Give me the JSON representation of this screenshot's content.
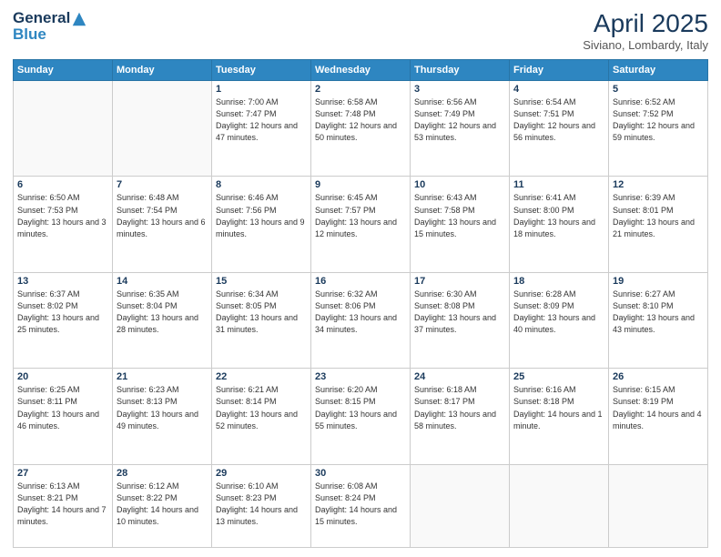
{
  "header": {
    "logo_line1": "General",
    "logo_line2": "Blue",
    "month": "April 2025",
    "location": "Siviano, Lombardy, Italy"
  },
  "weekdays": [
    "Sunday",
    "Monday",
    "Tuesday",
    "Wednesday",
    "Thursday",
    "Friday",
    "Saturday"
  ],
  "weeks": [
    [
      {
        "day": "",
        "info": ""
      },
      {
        "day": "",
        "info": ""
      },
      {
        "day": "1",
        "info": "Sunrise: 7:00 AM\nSunset: 7:47 PM\nDaylight: 12 hours and 47 minutes."
      },
      {
        "day": "2",
        "info": "Sunrise: 6:58 AM\nSunset: 7:48 PM\nDaylight: 12 hours and 50 minutes."
      },
      {
        "day": "3",
        "info": "Sunrise: 6:56 AM\nSunset: 7:49 PM\nDaylight: 12 hours and 53 minutes."
      },
      {
        "day": "4",
        "info": "Sunrise: 6:54 AM\nSunset: 7:51 PM\nDaylight: 12 hours and 56 minutes."
      },
      {
        "day": "5",
        "info": "Sunrise: 6:52 AM\nSunset: 7:52 PM\nDaylight: 12 hours and 59 minutes."
      }
    ],
    [
      {
        "day": "6",
        "info": "Sunrise: 6:50 AM\nSunset: 7:53 PM\nDaylight: 13 hours and 3 minutes."
      },
      {
        "day": "7",
        "info": "Sunrise: 6:48 AM\nSunset: 7:54 PM\nDaylight: 13 hours and 6 minutes."
      },
      {
        "day": "8",
        "info": "Sunrise: 6:46 AM\nSunset: 7:56 PM\nDaylight: 13 hours and 9 minutes."
      },
      {
        "day": "9",
        "info": "Sunrise: 6:45 AM\nSunset: 7:57 PM\nDaylight: 13 hours and 12 minutes."
      },
      {
        "day": "10",
        "info": "Sunrise: 6:43 AM\nSunset: 7:58 PM\nDaylight: 13 hours and 15 minutes."
      },
      {
        "day": "11",
        "info": "Sunrise: 6:41 AM\nSunset: 8:00 PM\nDaylight: 13 hours and 18 minutes."
      },
      {
        "day": "12",
        "info": "Sunrise: 6:39 AM\nSunset: 8:01 PM\nDaylight: 13 hours and 21 minutes."
      }
    ],
    [
      {
        "day": "13",
        "info": "Sunrise: 6:37 AM\nSunset: 8:02 PM\nDaylight: 13 hours and 25 minutes."
      },
      {
        "day": "14",
        "info": "Sunrise: 6:35 AM\nSunset: 8:04 PM\nDaylight: 13 hours and 28 minutes."
      },
      {
        "day": "15",
        "info": "Sunrise: 6:34 AM\nSunset: 8:05 PM\nDaylight: 13 hours and 31 minutes."
      },
      {
        "day": "16",
        "info": "Sunrise: 6:32 AM\nSunset: 8:06 PM\nDaylight: 13 hours and 34 minutes."
      },
      {
        "day": "17",
        "info": "Sunrise: 6:30 AM\nSunset: 8:08 PM\nDaylight: 13 hours and 37 minutes."
      },
      {
        "day": "18",
        "info": "Sunrise: 6:28 AM\nSunset: 8:09 PM\nDaylight: 13 hours and 40 minutes."
      },
      {
        "day": "19",
        "info": "Sunrise: 6:27 AM\nSunset: 8:10 PM\nDaylight: 13 hours and 43 minutes."
      }
    ],
    [
      {
        "day": "20",
        "info": "Sunrise: 6:25 AM\nSunset: 8:11 PM\nDaylight: 13 hours and 46 minutes."
      },
      {
        "day": "21",
        "info": "Sunrise: 6:23 AM\nSunset: 8:13 PM\nDaylight: 13 hours and 49 minutes."
      },
      {
        "day": "22",
        "info": "Sunrise: 6:21 AM\nSunset: 8:14 PM\nDaylight: 13 hours and 52 minutes."
      },
      {
        "day": "23",
        "info": "Sunrise: 6:20 AM\nSunset: 8:15 PM\nDaylight: 13 hours and 55 minutes."
      },
      {
        "day": "24",
        "info": "Sunrise: 6:18 AM\nSunset: 8:17 PM\nDaylight: 13 hours and 58 minutes."
      },
      {
        "day": "25",
        "info": "Sunrise: 6:16 AM\nSunset: 8:18 PM\nDaylight: 14 hours and 1 minute."
      },
      {
        "day": "26",
        "info": "Sunrise: 6:15 AM\nSunset: 8:19 PM\nDaylight: 14 hours and 4 minutes."
      }
    ],
    [
      {
        "day": "27",
        "info": "Sunrise: 6:13 AM\nSunset: 8:21 PM\nDaylight: 14 hours and 7 minutes."
      },
      {
        "day": "28",
        "info": "Sunrise: 6:12 AM\nSunset: 8:22 PM\nDaylight: 14 hours and 10 minutes."
      },
      {
        "day": "29",
        "info": "Sunrise: 6:10 AM\nSunset: 8:23 PM\nDaylight: 14 hours and 13 minutes."
      },
      {
        "day": "30",
        "info": "Sunrise: 6:08 AM\nSunset: 8:24 PM\nDaylight: 14 hours and 15 minutes."
      },
      {
        "day": "",
        "info": ""
      },
      {
        "day": "",
        "info": ""
      },
      {
        "day": "",
        "info": ""
      }
    ]
  ]
}
